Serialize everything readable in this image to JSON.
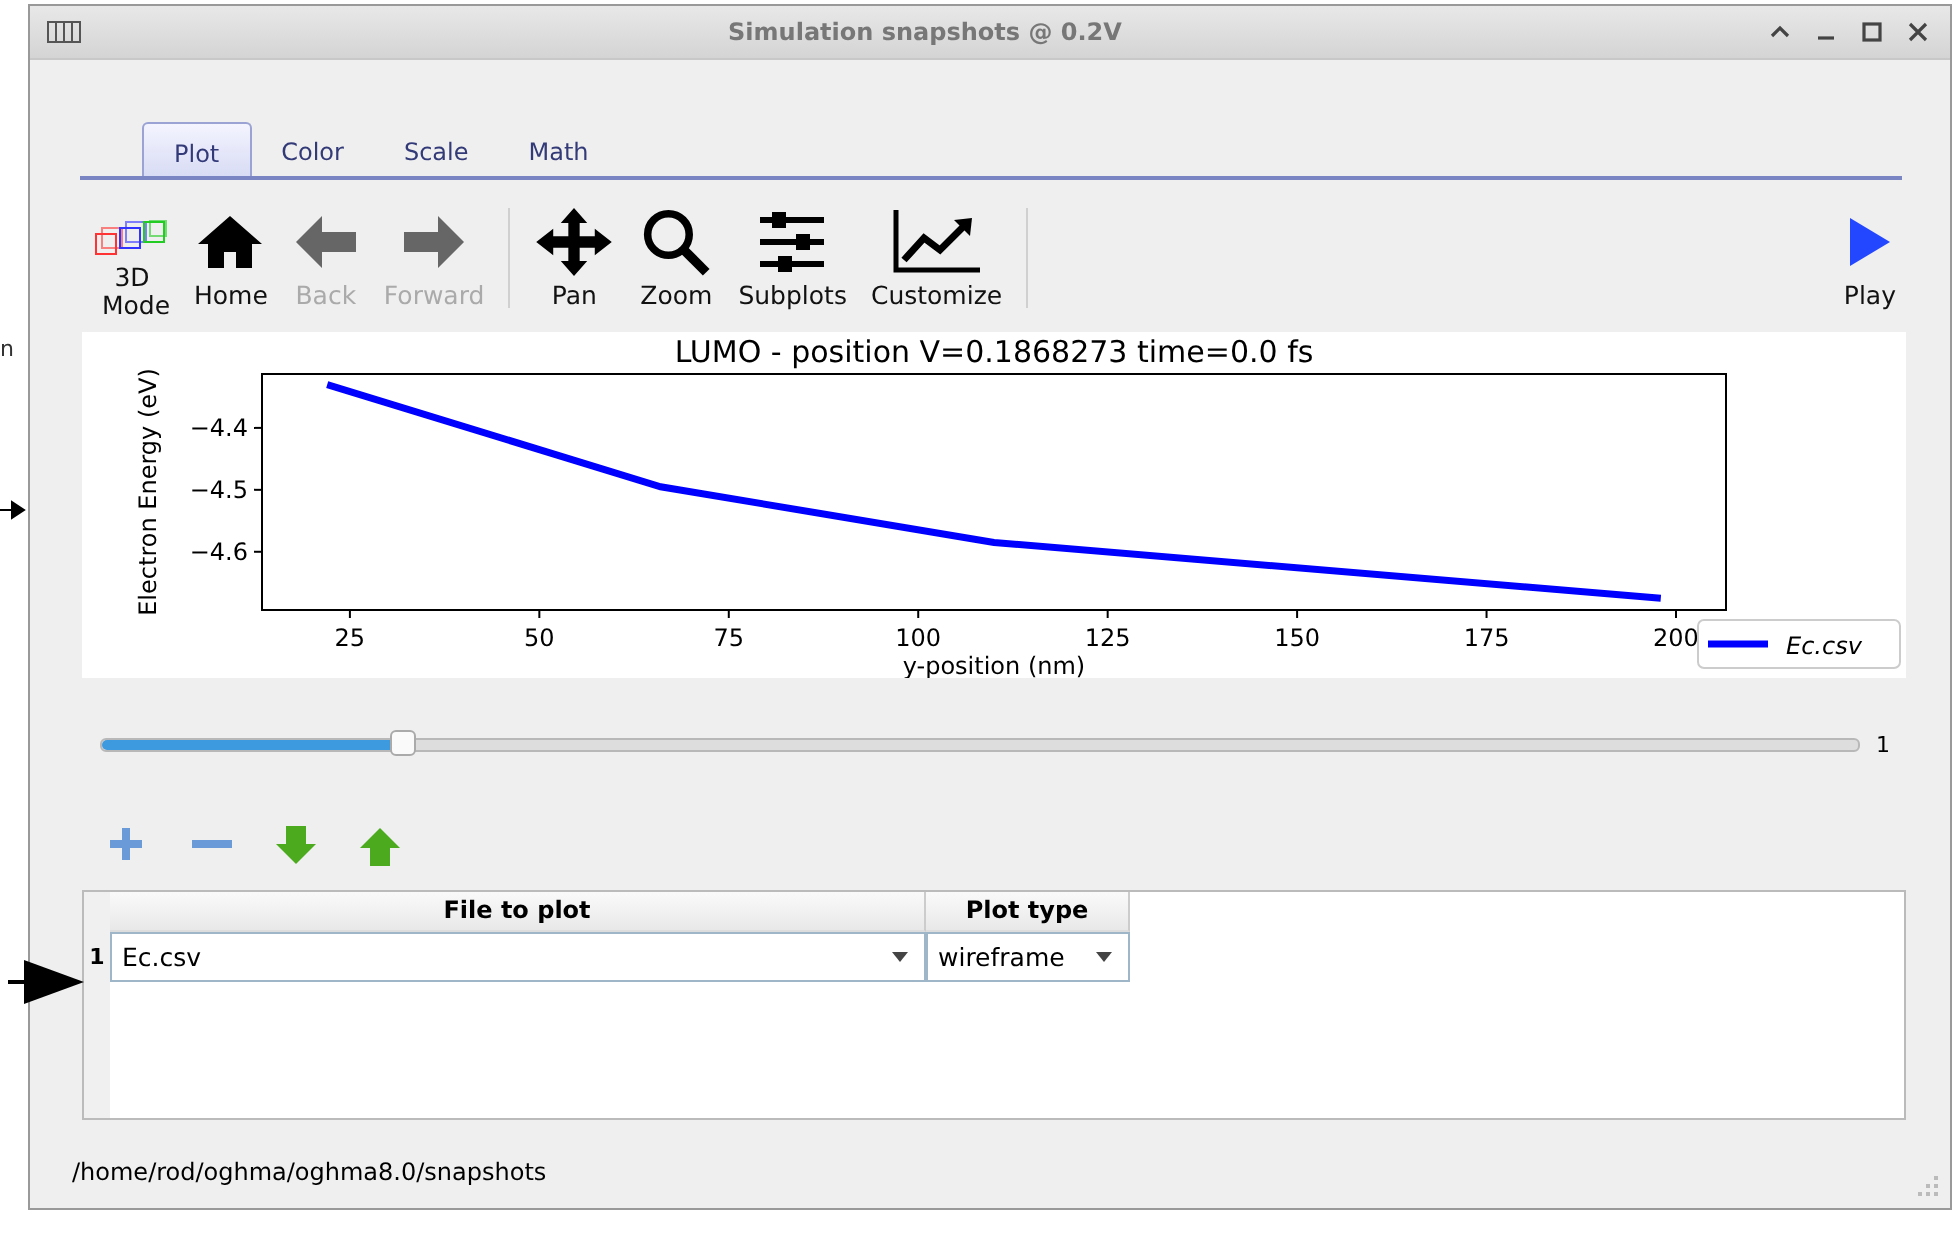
{
  "background": {
    "text": "n"
  },
  "window": {
    "title": "Simulation snapshots @ 0.2V"
  },
  "tabs": [
    {
      "label": "Plot",
      "selected": true
    },
    {
      "label": "Color",
      "selected": false
    },
    {
      "label": "Scale",
      "selected": false
    },
    {
      "label": "Math",
      "selected": false
    }
  ],
  "toolbar": [
    {
      "label": "3D Mode",
      "disabled": false
    },
    {
      "label": "Home",
      "disabled": false
    },
    {
      "label": "Back",
      "disabled": true
    },
    {
      "label": "Forward",
      "disabled": true
    },
    {
      "label": "Pan",
      "disabled": false
    },
    {
      "label": "Zoom",
      "disabled": false
    },
    {
      "label": "Subplots",
      "disabled": false
    },
    {
      "label": "Customize",
      "disabled": false
    }
  ],
  "play_button": {
    "label": "Play"
  },
  "plot": {
    "chart_data": {
      "type": "line",
      "title": "LUMO - position V=0.1868273 time=0.0 fs",
      "xlabel": "y-position (nm)",
      "ylabel": "Electron Energy (eV)",
      "xlim": [
        13.4,
        206.6
      ],
      "ylim": [
        -4.694,
        -4.313
      ],
      "xticks": [
        25,
        50,
        75,
        100,
        125,
        150,
        175,
        200
      ],
      "yticks": [
        -4.4,
        -4.5,
        -4.6
      ],
      "x": [
        22,
        66,
        110,
        198
      ],
      "series": [
        {
          "name": "Ec.csv",
          "color": "#0000ff",
          "values": [
            -4.33,
            -4.495,
            -4.585,
            -4.675
          ]
        }
      ]
    }
  },
  "slider": {
    "level": 0.172,
    "reading": "1"
  },
  "table": {
    "columns": [
      "File to plot",
      "Plot type"
    ],
    "rows": [
      {
        "number": "1",
        "file": "Ec.csv",
        "plot_type": "wireframe"
      }
    ]
  },
  "status_bar": {
    "path": "/home/rod/oghma/oghma8.0/snapshots"
  }
}
